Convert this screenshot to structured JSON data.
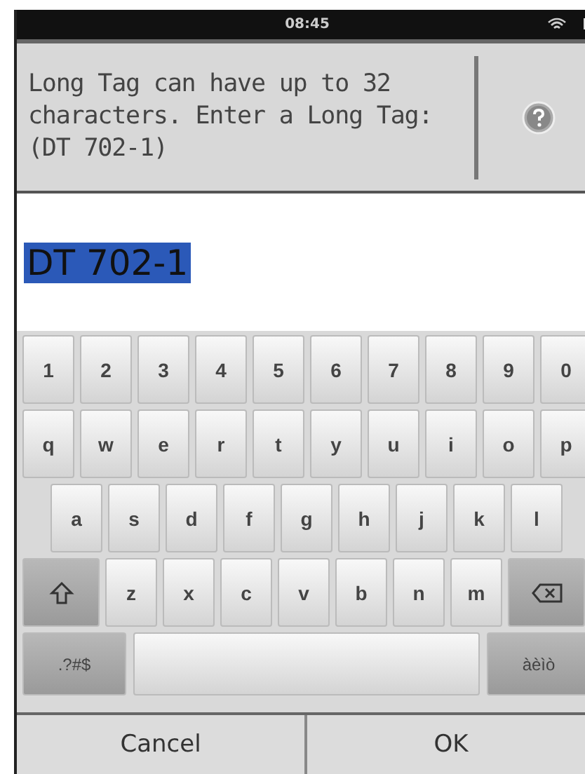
{
  "status_bar": {
    "time": "08:45"
  },
  "prompt": {
    "text": "Long Tag can have up to 32 characters. Enter a Long Tag: (DT 702-1)"
  },
  "input": {
    "value": "DT 702-1",
    "selected": true
  },
  "keyboard": {
    "rows": [
      {
        "keys": [
          {
            "kind": "char",
            "label": "1"
          },
          {
            "kind": "char",
            "label": "2"
          },
          {
            "kind": "char",
            "label": "3"
          },
          {
            "kind": "char",
            "label": "4"
          },
          {
            "kind": "char",
            "label": "5"
          },
          {
            "kind": "char",
            "label": "6"
          },
          {
            "kind": "char",
            "label": "7"
          },
          {
            "kind": "char",
            "label": "8"
          },
          {
            "kind": "char",
            "label": "9"
          },
          {
            "kind": "char",
            "label": "0"
          }
        ]
      },
      {
        "keys": [
          {
            "kind": "char",
            "label": "q"
          },
          {
            "kind": "char",
            "label": "w"
          },
          {
            "kind": "char",
            "label": "e"
          },
          {
            "kind": "char",
            "label": "r"
          },
          {
            "kind": "char",
            "label": "t"
          },
          {
            "kind": "char",
            "label": "y"
          },
          {
            "kind": "char",
            "label": "u"
          },
          {
            "kind": "char",
            "label": "i"
          },
          {
            "kind": "char",
            "label": "o"
          },
          {
            "kind": "char",
            "label": "p"
          }
        ]
      },
      {
        "keys": [
          {
            "kind": "char",
            "label": "a"
          },
          {
            "kind": "char",
            "label": "s"
          },
          {
            "kind": "char",
            "label": "d"
          },
          {
            "kind": "char",
            "label": "f"
          },
          {
            "kind": "char",
            "label": "g"
          },
          {
            "kind": "char",
            "label": "h"
          },
          {
            "kind": "char",
            "label": "j"
          },
          {
            "kind": "char",
            "label": "k"
          },
          {
            "kind": "char",
            "label": "l"
          }
        ]
      },
      {
        "keys": [
          {
            "kind": "shift"
          },
          {
            "kind": "char",
            "label": "z"
          },
          {
            "kind": "char",
            "label": "x"
          },
          {
            "kind": "char",
            "label": "c"
          },
          {
            "kind": "char",
            "label": "v"
          },
          {
            "kind": "char",
            "label": "b"
          },
          {
            "kind": "char",
            "label": "n"
          },
          {
            "kind": "char",
            "label": "m"
          },
          {
            "kind": "backspace"
          }
        ]
      },
      {
        "keys": [
          {
            "kind": "mode",
            "label": ".?#$"
          },
          {
            "kind": "space"
          },
          {
            "kind": "mode",
            "label": "àèìò"
          }
        ]
      }
    ]
  },
  "buttons": [
    "Cancel",
    "OK"
  ]
}
